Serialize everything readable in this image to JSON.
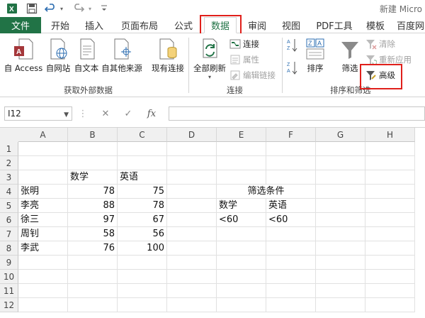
{
  "title_bar": {
    "app_title": "新建 Micro"
  },
  "tabs": {
    "file": "文件",
    "items": [
      "开始",
      "插入",
      "页面布局",
      "公式",
      "数据",
      "审阅",
      "视图",
      "PDF工具",
      "模板",
      "百度网"
    ],
    "active": "数据"
  },
  "ribbon": {
    "get_external": {
      "access": "自 Access",
      "web": "自网站",
      "text": "自文本",
      "other": "自其他来源",
      "existing": "现有连接",
      "label": "获取外部数据"
    },
    "connections": {
      "refresh_all": "全部刷新",
      "connections": "连接",
      "properties": "属性",
      "edit_links": "编辑链接",
      "label": "连接"
    },
    "sort_filter": {
      "sort": "排序",
      "filter": "筛选",
      "clear": "清除",
      "reapply": "重新应用",
      "advanced": "高级",
      "label": "排序和筛选"
    }
  },
  "formula_bar": {
    "name_box": "I12",
    "fx_symbol": "fx",
    "cancel_symbol": "✕",
    "enter_symbol": "✓",
    "formula": ""
  },
  "sheet": {
    "columns": [
      "A",
      "B",
      "C",
      "D",
      "E",
      "F",
      "G",
      "H"
    ],
    "rows": [
      "1",
      "2",
      "3",
      "4",
      "5",
      "6",
      "7",
      "8",
      "9",
      "10",
      "11",
      "12"
    ],
    "cells": {
      "B3": "数学",
      "C3": "英语",
      "A4": "张明",
      "B4": "78",
      "C4": "75",
      "A5": "李亮",
      "B5": "88",
      "C5": "78",
      "A6": "徐三",
      "B6": "97",
      "C6": "67",
      "A7": "周钊",
      "B7": "58",
      "C7": "56",
      "A8": "李武",
      "B8": "76",
      "C8": "100",
      "E4": "筛选条件",
      "E5": "数学",
      "F5": "英语",
      "E6": "<60",
      "F6": "<60"
    }
  },
  "colors": {
    "excel_green": "#217346",
    "highlight_red": "#e0201b"
  }
}
